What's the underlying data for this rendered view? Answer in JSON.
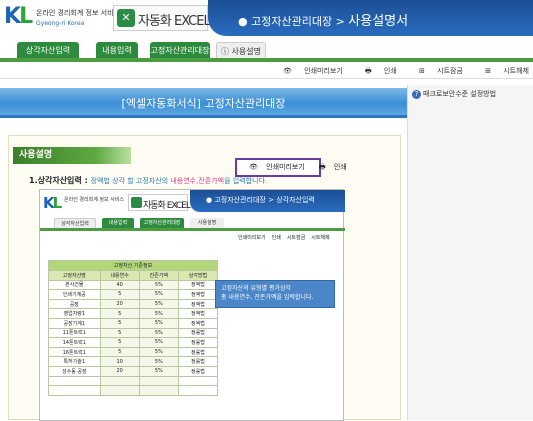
{
  "header": {
    "logo_letters": "KL",
    "logo_tagline": "온라인 경리회계 정보 서비스",
    "logo_sub": "Gyeong-ri Korea",
    "product_name": "자동화 EXCEL",
    "breadcrumb_parent": "고정자산관리대장",
    "breadcrumb_current": "사용설명서"
  },
  "tabs": [
    {
      "label": "상각자산입력",
      "active": false
    },
    {
      "label": "내용입력",
      "active": false
    },
    {
      "label": "고정자산관리대장",
      "active": false
    },
    {
      "label": "사용설명",
      "active": true
    }
  ],
  "toolbar": {
    "preview": "인쇄미리보기",
    "print": "인쇄",
    "sheet_protect": "시트잠금",
    "sheet_unprotect": "시트해제"
  },
  "banner_title": "[엑셀자동화서식] 고정자산관리대장",
  "right_panel": {
    "item": "매크로보안수준 설정방법"
  },
  "section_title": "사용설명",
  "instruction": {
    "number": "1.",
    "label": "상각자산입력",
    "desc_before": "정액법 상각 할 고정자산의 ",
    "highlight": "내용연수,잔존가액",
    "desc_after": "을 입력합니다."
  },
  "inner_screenshot": {
    "product_name": "자동화 EXCEL",
    "breadcrumb_parent": "고정자산관리대장",
    "breadcrumb_current": "상각자산입력",
    "tabs": [
      "상각자산입력",
      "내용입력",
      "고정자산관리대장",
      "사용설명"
    ],
    "tools": [
      "인쇄미리보기",
      "인쇄",
      "시트잠금",
      "시트해제"
    ],
    "callout": [
      "인쇄미리보기",
      "인쇄"
    ],
    "table_caption": "고정자산 기준정보",
    "table_headers": [
      "고정자산명",
      "내용연수",
      "잔존가액",
      "상각방법"
    ],
    "table_rows": [
      [
        "본사건물",
        "40",
        "5%",
        "정액법"
      ],
      [
        "인쇄기계공",
        "5",
        "5%",
        "정액법"
      ],
      [
        "공장",
        "20",
        "5%",
        "정액법"
      ],
      [
        "영업차량1",
        "5",
        "5%",
        "정액법"
      ],
      [
        "공장기계1",
        "5",
        "5%",
        "정액법"
      ],
      [
        "11톤트럭1",
        "5",
        "5%",
        "정률법"
      ],
      [
        "14톤트럭1",
        "5",
        "5%",
        "정률법"
      ],
      [
        "16톤트럭1",
        "5",
        "5%",
        "정률법"
      ],
      [
        "특허기술1",
        "10",
        "5%",
        "정률법"
      ],
      [
        "성수동 공장",
        "20",
        "5%",
        "정률법"
      ],
      [
        "",
        "",
        "",
        ""
      ],
      [
        "",
        "",
        "",
        ""
      ]
    ],
    "note_line1": "고정자산의 유형별 평가상각",
    "note_line2": "총 내용연수, 잔존가액을 입력합니다."
  }
}
